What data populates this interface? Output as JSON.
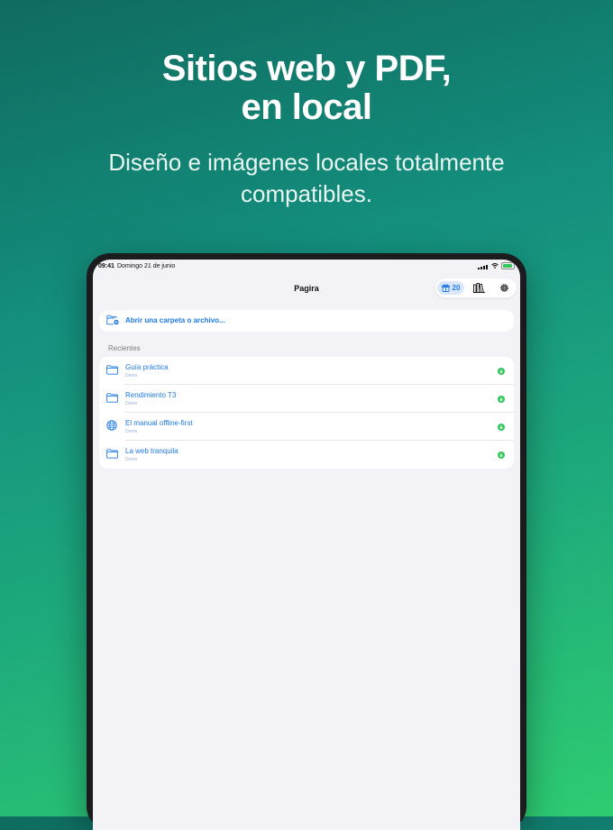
{
  "hero": {
    "title_line1": "Sitios web y PDF,",
    "title_line2": "en local",
    "subtitle_line1": "Diseño e imágenes locales totalmente",
    "subtitle_line2": "compatibles."
  },
  "status_bar": {
    "time": "09:41",
    "date": "Domingo 21 de junio",
    "battery_icon": "battery-icon",
    "wifi_icon": "wifi-icon",
    "signal_icon": "signal-icon"
  },
  "nav": {
    "title": "Pagira",
    "gift_count": "20",
    "gift_icon": "gift-icon",
    "library_icon": "library-icon",
    "settings_icon": "gear-icon"
  },
  "open_action": {
    "label": "Abrir una carpeta o archivo...",
    "icon": "folder-add-icon"
  },
  "recents": {
    "header": "Recientes",
    "items": [
      {
        "title": "Guía práctica",
        "subtitle": "Demo",
        "icon": "folder-icon"
      },
      {
        "title": "Rendimiento T3",
        "subtitle": "Demo",
        "icon": "folder-icon"
      },
      {
        "title": "El manual offline-first",
        "subtitle": "Demo",
        "icon": "globe-icon"
      },
      {
        "title": "La web tranquila",
        "subtitle": "Demo",
        "icon": "folder-icon"
      }
    ]
  },
  "colors": {
    "accent": "#1e7ae6",
    "downloaded_status": "#34c759",
    "background_gradient_start": "#0f6b5f",
    "background_gradient_end": "#2ecc71"
  }
}
